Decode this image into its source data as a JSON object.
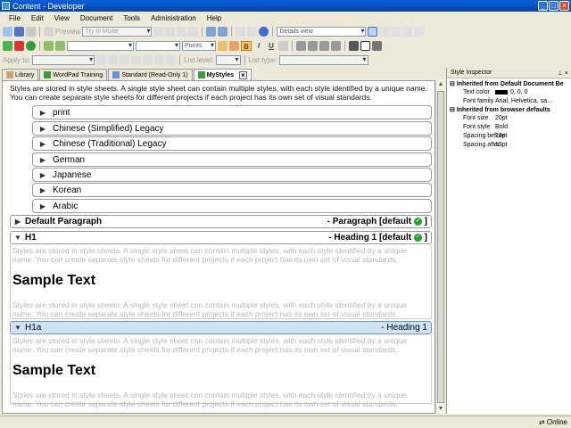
{
  "window": {
    "title": "Content - Developer",
    "minimize": "_",
    "maximize": "□",
    "close": "×"
  },
  "menu": [
    "File",
    "Edit",
    "View",
    "Document",
    "Tools",
    "Administration",
    "Help"
  ],
  "toolbar1": {
    "preview_label": "Preview",
    "try_mode": "Try It! Mode",
    "view_mode": "Details view"
  },
  "toolbar2": {
    "font_unit": "Points",
    "bold": "B",
    "italic": "I",
    "underline": "U"
  },
  "toolbar3": {
    "apply_to": "Apply to:",
    "list_level": "List level:",
    "list_type": "List type:"
  },
  "tabs": [
    {
      "label": "Library"
    },
    {
      "label": "WordPad Training"
    },
    {
      "label": "Standard (Read-Only 1)"
    },
    {
      "label": "MyStyles",
      "close": "×"
    }
  ],
  "content": {
    "intro": "Styles are stored in style sheets. A single style sheet can contain multiple styles, with each style identified by a unique name. You can create separate style sheets for different projects if each project has its own set of visual standards.",
    "languages": [
      "print",
      "Chinese (Simplified) Legacy",
      "Chinese (Traditional) Legacy",
      "German",
      "Japanese",
      "Korean",
      "Arabic"
    ],
    "styles": [
      {
        "name": "Default Paragraph",
        "info": "- Paragraph [default",
        "suffix": "]",
        "expanded": false
      },
      {
        "name": "H1",
        "info": "- Heading 1 [default",
        "suffix": "]",
        "expanded": true
      },
      {
        "name": "H1a",
        "info": "- Heading 1",
        "expanded": true,
        "selected": true
      }
    ],
    "preview_text": "Styles are stored in style sheets. A single style sheet can contain multiple styles, with each style identified by a unique name. You can create separate style sheets for different projects if each project has its own set of visual standards.",
    "sample_text": "Sample Text",
    "check_glyph": "✓",
    "collapsed_glyph": "▶",
    "expanded_glyph": "▼"
  },
  "inspector": {
    "title": "Style Inspector",
    "pin": "⊥ ×",
    "group1": "Inherited from Default Document Be",
    "props1": [
      {
        "key": "Text color",
        "value": "0, 0, 0",
        "swatch": "#000000"
      },
      {
        "key": "Font family",
        "value": "Arial, Helvetica, sa..."
      }
    ],
    "group2": "Inherited from browser defaults",
    "props2": [
      {
        "key": "Font size",
        "value": "20pt"
      },
      {
        "key": "Font style",
        "value": "Bold"
      },
      {
        "key": "Spacing before",
        "value": "13pt"
      },
      {
        "key": "Spacing after",
        "value": "13pt"
      }
    ]
  },
  "status": {
    "text": "Online"
  },
  "colors": {
    "titlebar": "#0a5fd8",
    "selected_row": "#cfe3f7",
    "check": "#23a323",
    "ghost_text": "#b8b8b8"
  }
}
